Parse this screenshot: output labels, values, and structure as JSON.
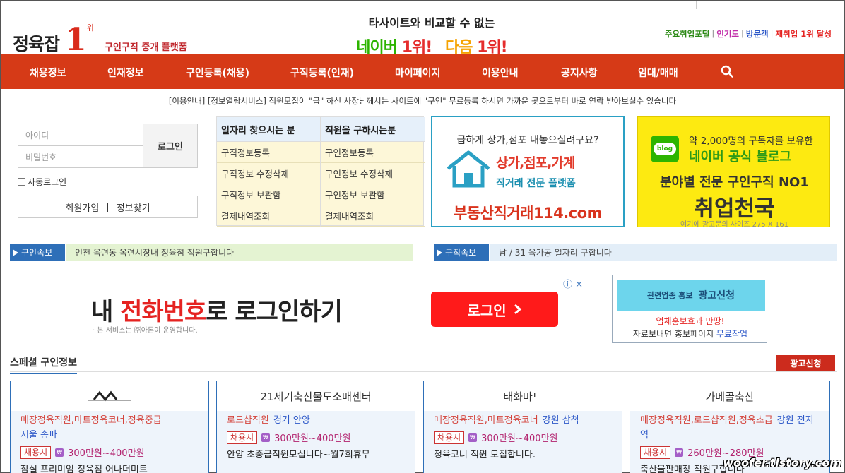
{
  "header": {
    "logo_name": "정육잡",
    "logo_rank": "1",
    "logo_rank_unit": "위",
    "tagline": "구인구직 중개 플랫폼",
    "headline_top": "타사이트와 비교할 수 없는",
    "headline_naver": "네이버",
    "headline_naver_rank": "1위!",
    "headline_daum": "다음",
    "headline_daum_rank": "1위!",
    "portal_links": [
      {
        "label": "주요취업포털",
        "color": "#2d8a17"
      },
      {
        "label": "인기도",
        "color": "#c02aa8"
      },
      {
        "label": "방문객",
        "color": "#2c57c8"
      },
      {
        "label": "재취업 1위 달성",
        "color": "#e52321"
      }
    ]
  },
  "nav": {
    "items": [
      "채용정보",
      "인재정보",
      "구인등록(채용)",
      "구직등록(인재)",
      "마이페이지",
      "이용안내",
      "공지사항",
      "임대/매매"
    ],
    "search_icon": "search-icon"
  },
  "notice": "[이용안내] [정보열람서비스] 직원모집이 \"급\" 하신 사장님께서는 사이트에 \"구인\" 무료등록 하시면 가까운 곳으로부터 바로 연락 받아보실수 있습니다",
  "login": {
    "id_placeholder": "아이디",
    "pw_placeholder": "비밀번호",
    "login_label": "로그인",
    "auto_login": "자동로그인",
    "join": "회원가입",
    "find": "정보찾기"
  },
  "menu": {
    "left_head": "일자리 찾으시는 분",
    "right_head": "직원을 구하시는분",
    "left_links": [
      "구직정보등록",
      "구직정보 수정삭제",
      "구직정보 보관함",
      "결제내역조회"
    ],
    "right_links": [
      "구인정보등록",
      "구인정보 수정삭제",
      "구인정보 보관함",
      "결제내역조회"
    ]
  },
  "ad1": {
    "question": "급하게 상가,점포 내놓으실려구요?",
    "big": "상가,점포,가계",
    "sub": "직거래 전문 플랫폼",
    "site": "부동산직거래114.com"
  },
  "ad2": {
    "blog_badge": "blog",
    "line1": "약 2,000명의 구독자를 보유한",
    "line2": "네이버 공식 블로그",
    "line3": "분야별 전문 구인구직 NO1",
    "line4": "취업천국",
    "note": "여기에 광고문의 사이즈 275 X 161"
  },
  "tickers": {
    "left_label": "구인속보",
    "left_text": "인천 옥련동 옥련시장내 정육점 직원구합니다",
    "right_label": "구직속보",
    "right_text": "남 / 31 육가공 일자리 구합니다"
  },
  "ad3": {
    "title_pre": "내 ",
    "title_red": "전화번호",
    "title_post": "로 로그인하기",
    "sub": "· 본 서비스는 ㈜아톤이 운영합니다.",
    "button": "로그인",
    "close": "ⓘ ✕"
  },
  "ad4": {
    "head_small": "관련업종 홍보",
    "head_big": "광고신청",
    "l1_red": "업체홍보효과 만땅!",
    "l2_pre": "자료보내면 홍보페이지 ",
    "l2_blue": "무료작업"
  },
  "special": {
    "title": "스페셜 구인정보",
    "apply": "광고신청",
    "cards": [
      {
        "name": "",
        "job": "매장정육직원,마트정육코너,정육중급",
        "loc": "서울 송파",
        "badge": "채용시",
        "pay": "300만원~400만원",
        "desc": "잠실 프리미엄 정육점 어나더미트"
      },
      {
        "name": "21세기축산물도소매센터",
        "job": "로드샵직원",
        "loc": "경기 안양",
        "badge": "채용시",
        "pay": "300만원~400만원",
        "desc": "안양 초중급직원모십니다~월7회휴무"
      },
      {
        "name": "태화마트",
        "job": "매장정육직원,마트정육코너",
        "loc": "강원 삼척",
        "badge": "채용시",
        "pay": "300만원~400만원",
        "desc": "정육코너 직원 모집합니다."
      },
      {
        "name": "가메골축산",
        "job": "매장정육직원,로드샵직원,정육초급",
        "loc": "강원 전지역",
        "badge": "채용시",
        "pay": "260만원~280만원",
        "desc": "축산물판매장 직원구합니다"
      }
    ]
  },
  "watermark": "woofer.tistory.com",
  "colors": {
    "nav": "#d63a17",
    "accent_blue": "#2e6fb8",
    "accent_red": "#e52321"
  }
}
